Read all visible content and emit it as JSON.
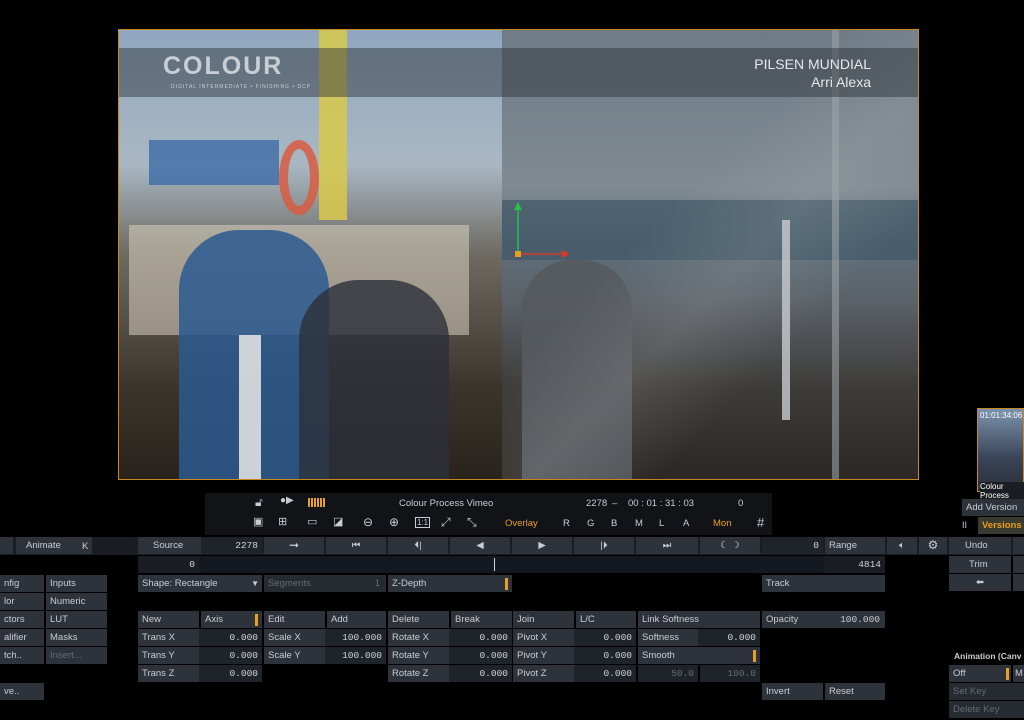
{
  "viewer": {
    "project_title": "PILSEN MUNDIAL",
    "camera": "Arri Alexa",
    "logo_text": "COLOUR",
    "logo_sub": "DIGITAL INTERMEDIATE • FINISHING • DCP",
    "border_color": "#c7881f"
  },
  "transport": {
    "lock_icon": "lock-icon",
    "record_icon": "record-icon",
    "clip_name": "Colour Process Vimeo",
    "frame": "2278",
    "separator": "–",
    "timecode": "00 : 01 : 31 : 03",
    "counter": "0",
    "row2": [
      "▣",
      "⊞",
      "▭",
      "◪",
      "⊖",
      "⊕",
      "1:1",
      "⤢",
      "⤡"
    ],
    "overlay": "Overlay",
    "channels": [
      "R",
      "G",
      "B",
      "M",
      "L",
      "A"
    ],
    "mon": "Mon",
    "grid_icon": "#"
  },
  "thumbnail": {
    "timecode": "01:01:34:06",
    "label": "Colour Process"
  },
  "versions": {
    "add_version": "Add Version",
    "versions_label": "Versions"
  },
  "toolbar": {
    "animate": "Animate",
    "k": "K",
    "source": "Source",
    "frame": "2278",
    "range_value": "0",
    "range": "Range",
    "undo": "Undo",
    "trim": "Trim",
    "timeline_start": "0",
    "timeline_end": "4814"
  },
  "left_menu": {
    "col1": [
      "nfig",
      "lor",
      "ctors",
      "alifier",
      "tch.."
    ],
    "col2": [
      "Inputs",
      "Numeric",
      "LUT",
      "Masks",
      "Insert..."
    ],
    "save": "ve.."
  },
  "shape": {
    "shape_label": "Shape: Rectangle",
    "segments_label": "Segments",
    "segments_value": "1",
    "zdepth": "Z-Depth",
    "track": "Track"
  },
  "actions": {
    "new": "New",
    "axis": "Axis",
    "edit": "Edit",
    "add": "Add",
    "delete": "Delete",
    "break": "Break",
    "join": "Join",
    "lc": "L/C",
    "link_softness": "Link Softness",
    "opacity": "Opacity",
    "opacity_value": "100.000"
  },
  "params": {
    "trans_x": "Trans X",
    "trans_x_v": "0.000",
    "trans_y": "Trans Y",
    "trans_y_v": "0.000",
    "trans_z": "Trans Z",
    "trans_z_v": "0.000",
    "scale_x": "Scale X",
    "scale_x_v": "100.000",
    "scale_y": "Scale Y",
    "scale_y_v": "100.000",
    "rotate_x": "Rotate X",
    "rotate_x_v": "0.000",
    "rotate_y": "Rotate Y",
    "rotate_y_v": "0.000",
    "rotate_z": "Rotate Z",
    "rotate_z_v": "0.000",
    "pivot_x": "Pivot X",
    "pivot_x_v": "0.000",
    "pivot_y": "Pivot Y",
    "pivot_y_v": "0.000",
    "pivot_z": "Pivot Z",
    "pivot_z_v": "0.000",
    "softness": "Softness",
    "softness_v": "0.000",
    "smooth": "Smooth",
    "inner_v": "50.0",
    "outer_v": "100.0",
    "invert": "Invert",
    "reset": "Reset"
  },
  "animation": {
    "title": "Animation (Canv",
    "off": "Off",
    "m": "M",
    "set_key": "Set Key",
    "delete_key": "Delete Key"
  },
  "colors": {
    "accent": "#e8a020",
    "panel_button": "#2e333b",
    "panel_field": "#1f242b"
  }
}
